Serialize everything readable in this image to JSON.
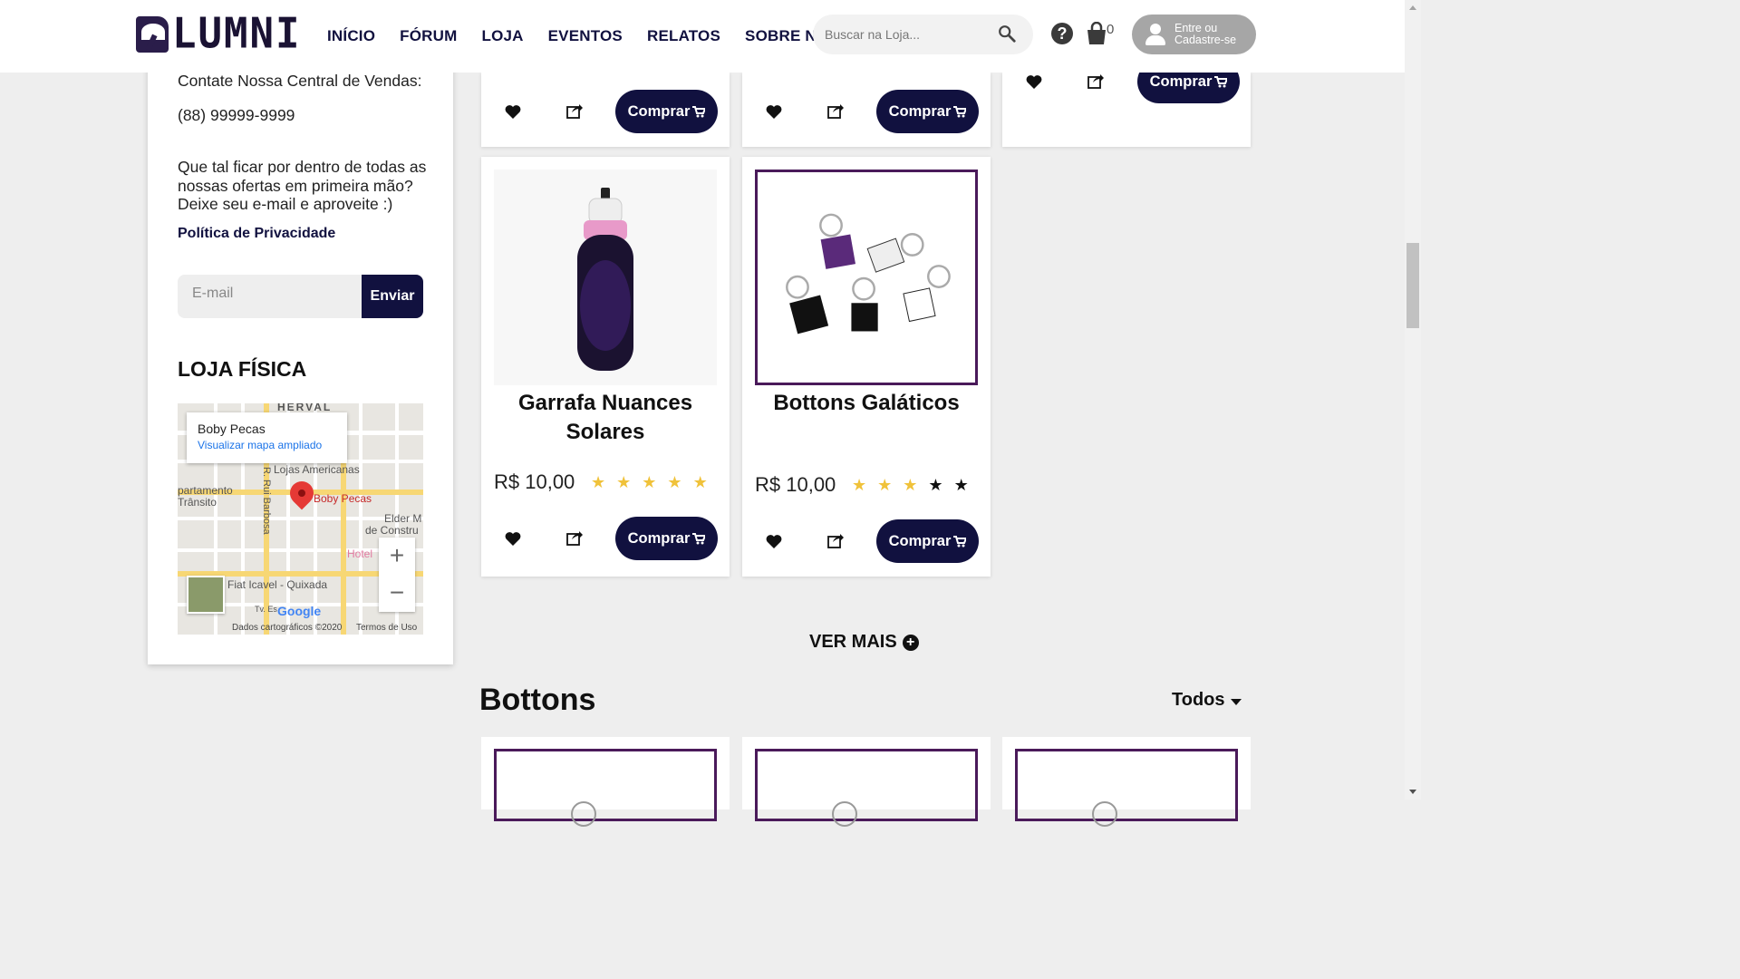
{
  "header": {
    "logo_text": "LUMNI",
    "nav": [
      "INÍCIO",
      "FÓRUM",
      "LOJA",
      "EVENTOS",
      "RELATOS",
      "SOBRE NÓS"
    ],
    "search_placeholder": "Buscar na Loja...",
    "help_symbol": "?",
    "cart_count": "0",
    "login_line1": "Entre ou",
    "login_line2": "Cadastre-se"
  },
  "sidebar": {
    "contact_title": "Contate Nossa Central de Vendas:",
    "phone": "(88) 99999-9999",
    "newsletter_line1": "Que tal ficar por dentro de todas as",
    "newsletter_line2": "nossas ofertas em primeira mão?",
    "newsletter_line3": "Deixe seu e-mail e aproveite :)",
    "privacy_link": "Política de Privacidade",
    "email_placeholder": "E-mail",
    "send_label": "Enviar",
    "store_title": "LOJA FÍSICA",
    "map": {
      "place_name": "Boby Pecas",
      "enlarge_link": "Visualizar mapa ampliado",
      "labels": [
        "HERVAL",
        "Lojas Americanas",
        "R. Rui Barbosa",
        "Boby Pecas",
        "partamento",
        "Trânsito",
        "Elder M",
        "de Constru",
        "Hotel",
        "Fiat Icavel - Quixada",
        "Tv. Es"
      ],
      "zoom_in": "+",
      "zoom_out": "−",
      "google": "Google",
      "map_data": "Dados cartográficos ©2020",
      "terms": "Termos de Uso"
    }
  },
  "products_row1": [
    {
      "buy_label": "Comprar"
    },
    {
      "buy_label": "Comprar"
    },
    {
      "buy_label": "Comprar"
    }
  ],
  "products_row2": [
    {
      "name_line1": "Garrafa Nuances",
      "name_line2": "Solares",
      "price": "R$ 10,00",
      "rating": 5,
      "buy_label": "Comprar"
    },
    {
      "name_line1": "Bottons Galáticos",
      "name_line2": "",
      "price": "R$ 10,00",
      "rating": 3,
      "buy_label": "Comprar"
    }
  ],
  "ver_mais": "VER MAIS",
  "section": {
    "title": "Bottons",
    "filter": "Todos"
  },
  "colors": {
    "primary": "#11113f",
    "accent_frame": "#4a1a5a",
    "star": "#f0c23a"
  }
}
